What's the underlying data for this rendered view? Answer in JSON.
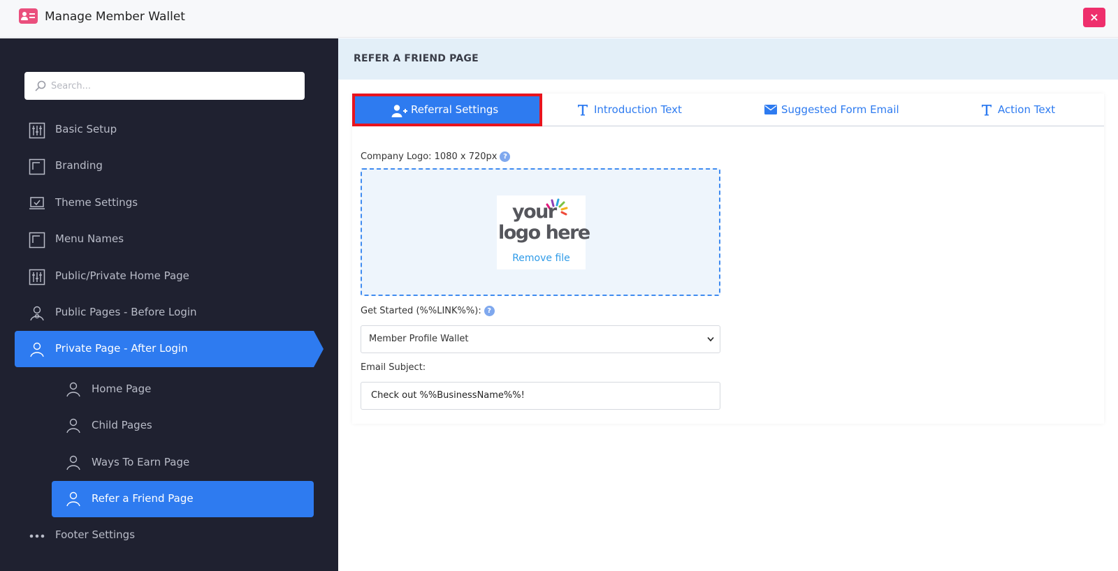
{
  "header": {
    "title": "Manage Member Wallet",
    "close_label": "×",
    "icon": "member-card-icon",
    "accent_color": "#ea4f7d"
  },
  "sidebar": {
    "search": {
      "placeholder": "Search..."
    },
    "items": [
      {
        "label": "Basic Setup",
        "icon": "sliders-icon"
      },
      {
        "label": "Branding",
        "icon": "square-frame-icon"
      },
      {
        "label": "Theme Settings",
        "icon": "laptop-check-icon"
      },
      {
        "label": "Menu Names",
        "icon": "square-frame-icon"
      },
      {
        "label": "Public/Private Home Page",
        "icon": "sliders-icon"
      },
      {
        "label": "Public Pages - Before Login",
        "icon": "person-icon"
      },
      {
        "label": "Private Page - After Login",
        "icon": "person-icon",
        "active": true
      }
    ],
    "sub_items": [
      {
        "label": "Home Page",
        "icon": "person-icon"
      },
      {
        "label": "Child Pages",
        "icon": "person-icon"
      },
      {
        "label": "Ways To Earn Page",
        "icon": "person-icon"
      },
      {
        "label": "Refer a Friend Page",
        "icon": "person-icon",
        "active": true
      }
    ],
    "footer_item": {
      "label": "Footer Settings",
      "icon": "dots-icon"
    },
    "active_color": "#2e7bf0",
    "background_color": "#1f2130"
  },
  "main": {
    "title": "REFER A FRIEND PAGE",
    "tabs": [
      {
        "label": "Referral Settings",
        "icon": "add-user-icon",
        "active": true
      },
      {
        "label": "Introduction Text",
        "icon": "text-icon"
      },
      {
        "label": "Suggested Form Email",
        "icon": "envelope-icon"
      },
      {
        "label": "Action Text",
        "icon": "text-icon"
      }
    ],
    "logo_field": {
      "label": "Company Logo: 1080 x 720px",
      "help": "?",
      "logo_text_line1": "your",
      "logo_text_line2": "logo here",
      "remove_label": "Remove file"
    },
    "get_started_field": {
      "label": "Get Started (%%LINK%%):",
      "help": "?",
      "selected": "Member Profile Wallet"
    },
    "email_subject_field": {
      "label": "Email Subject:",
      "value": "Check out %%BusinessName%%!"
    }
  }
}
